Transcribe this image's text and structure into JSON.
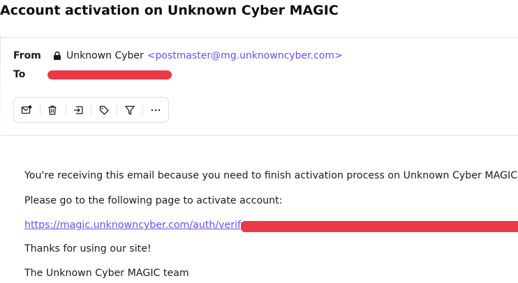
{
  "subject": "Account activation on Unknown Cyber MAGIC",
  "header": {
    "from_label": "From",
    "to_label": "To",
    "sender_name": "Unknown Cyber",
    "sender_email": "<postmaster@mg.unknowncyber.com>"
  },
  "toolbar": {
    "buttons": [
      {
        "icon": "mark-unread-icon"
      },
      {
        "icon": "trash-icon"
      },
      {
        "icon": "move-to-folder-icon"
      },
      {
        "icon": "label-tag-icon"
      },
      {
        "icon": "filter-icon"
      },
      {
        "icon": "more-options-icon"
      }
    ]
  },
  "body": {
    "line1": "You're receiving this email because you need to finish activation process on Unknown Cyber MAGIC.",
    "line2": "Please go to the following page to activate account:",
    "link": "https://magic.unknowncyber.com/auth/verify",
    "line4": "Thanks for using our site!",
    "line5": "The Unknown Cyber MAGIC team"
  },
  "colors": {
    "accent": "#6d4aff",
    "redaction": "#ea3a48"
  }
}
